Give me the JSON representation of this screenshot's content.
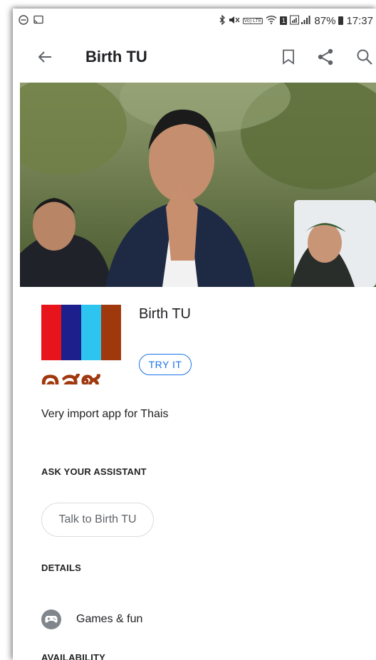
{
  "status_bar": {
    "left_icons": [
      "dnd-icon",
      "cast-icon"
    ],
    "right_icons": [
      "bluetooth-icon",
      "mute-icon",
      "volte-icon",
      "wifi-icon",
      "sim-icon",
      "signal-icon"
    ],
    "volte_label": "Vo)\nLTE",
    "sim_label": "1",
    "battery_percent": "87%",
    "time": "17:37"
  },
  "app_bar": {
    "title": "Birth TU",
    "actions": [
      "back-arrow-icon",
      "bookmark-icon",
      "share-icon",
      "search-icon"
    ]
  },
  "app": {
    "name": "Birth TU",
    "icon_text": "คสช.",
    "icon_colors": [
      "#e8141c",
      "#1d1f8c",
      "#2ec4f0",
      "#a0380e"
    ],
    "try_button": "TRY IT",
    "description": "Very import app for Thais"
  },
  "assistant": {
    "heading": "ASK YOUR ASSISTANT",
    "chip": "Talk to Birth TU"
  },
  "details": {
    "heading": "DETAILS",
    "category": "Games & fun",
    "category_icon": "gamepad-icon"
  },
  "availability": {
    "heading": "AVAILABILITY"
  },
  "colors": {
    "accent": "#1a73e8",
    "text_primary": "#202124",
    "text_secondary": "#5f6368",
    "chip_border": "#dadce0"
  }
}
